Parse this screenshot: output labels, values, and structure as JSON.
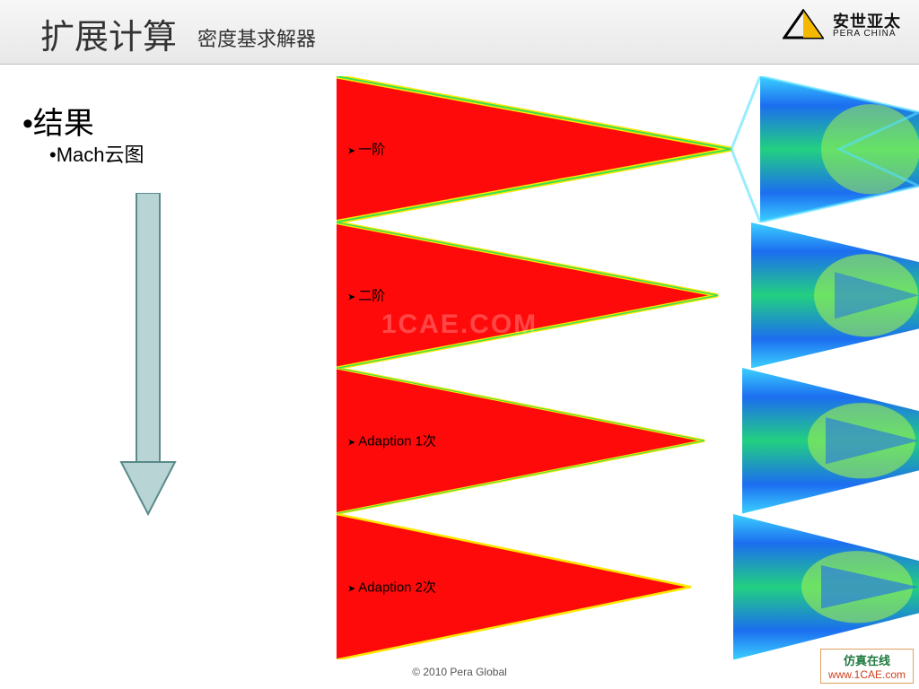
{
  "header": {
    "title_main": "扩展计算",
    "title_sub": "密度基求解器",
    "logo_cn": "安世亚太",
    "logo_en": "PERA CHINA"
  },
  "bullets": {
    "b1": "•结果",
    "b2": "•Mach云图"
  },
  "plots": [
    {
      "label": "一阶"
    },
    {
      "label": "二阶"
    },
    {
      "label": "Adaption 1次"
    },
    {
      "label": "Adaption 2次"
    }
  ],
  "watermark_center": "1CAE.COM",
  "footer": "© 2010 Pera Global",
  "wm_box": {
    "cn": "仿真在线",
    "url": "www.1CAE.com"
  }
}
